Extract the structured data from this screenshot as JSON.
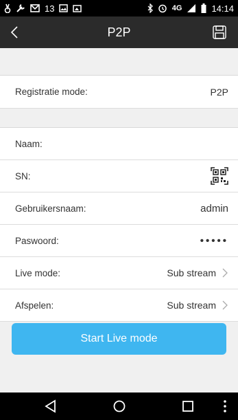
{
  "status_bar": {
    "notif_count": "13",
    "network": "4G",
    "time": "14:14"
  },
  "nav": {
    "title": "P2P"
  },
  "form": {
    "registration": {
      "label": "Registratie mode:",
      "value": "P2P"
    },
    "name": {
      "label": "Naam:",
      "value": ""
    },
    "sn": {
      "label": "SN:"
    },
    "username": {
      "label": "Gebruikersnaam:",
      "value": "admin"
    },
    "password": {
      "label": "Paswoord:",
      "value": "•••••"
    },
    "live_mode": {
      "label": "Live mode:",
      "value": "Sub stream"
    },
    "playback": {
      "label": "Afspelen:",
      "value": "Sub stream"
    }
  },
  "start_button": {
    "label": "Start Live mode"
  },
  "colors": {
    "accent": "#3fb6f0",
    "nav_bg": "#2b2b2b",
    "status_bg": "#000000"
  }
}
